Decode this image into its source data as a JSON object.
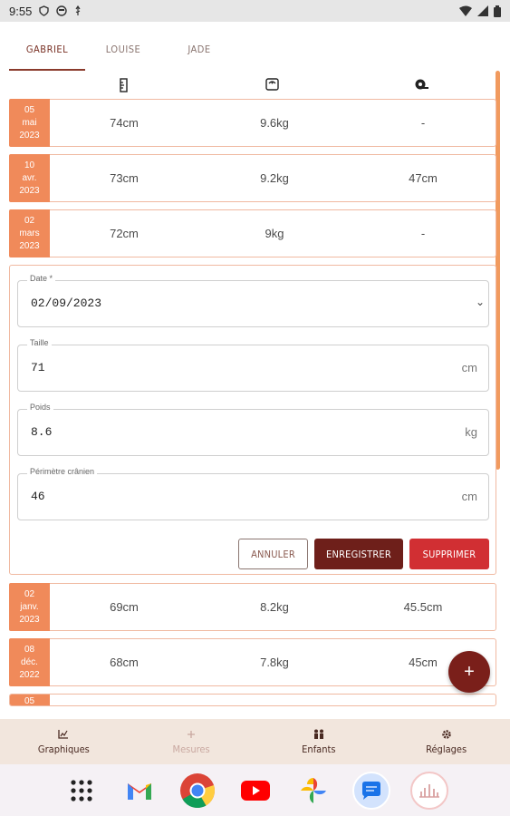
{
  "status_bar": {
    "time": "9:55"
  },
  "tabs": [
    {
      "label": "GABRIEL",
      "active": true
    },
    {
      "label": "LOUISE",
      "active": false
    },
    {
      "label": "JADE",
      "active": false
    }
  ],
  "columns": {
    "icons": [
      "ruler-icon",
      "scale-icon",
      "tape-measure-icon"
    ]
  },
  "rows_top": [
    {
      "day": "05",
      "month": "mai",
      "year": "2023",
      "taille": "74cm",
      "poids": "9.6kg",
      "perimetre": "-"
    },
    {
      "day": "10",
      "month": "avr.",
      "year": "2023",
      "taille": "73cm",
      "poids": "9.2kg",
      "perimetre": "47cm"
    },
    {
      "day": "02",
      "month": "mars",
      "year": "2023",
      "taille": "72cm",
      "poids": "9kg",
      "perimetre": "-"
    }
  ],
  "edit_form": {
    "date": {
      "label": "Date *",
      "value": "02/09/2023"
    },
    "taille": {
      "label": "Taille",
      "value": "71",
      "unit": "cm"
    },
    "poids": {
      "label": "Poids",
      "value": "8.6",
      "unit": "kg"
    },
    "perimetre": {
      "label": "Périmètre crânien",
      "value": "46",
      "unit": "cm"
    },
    "buttons": {
      "cancel": "ANNULER",
      "save": "ENREGISTRER",
      "delete": "SUPPRIMER"
    }
  },
  "rows_bottom": [
    {
      "day": "02",
      "month": "janv.",
      "year": "2023",
      "taille": "69cm",
      "poids": "8.2kg",
      "perimetre": "45.5cm"
    },
    {
      "day": "08",
      "month": "déc.",
      "year": "2022",
      "taille": "68cm",
      "poids": "7.8kg",
      "perimetre": "45cm"
    }
  ],
  "partial_row": {
    "day": "05"
  },
  "fab": {
    "label": "+"
  },
  "bottom_nav": [
    {
      "label": "Graphiques",
      "icon": "chart-icon"
    },
    {
      "label": "Mesures",
      "icon": "plus-icon"
    },
    {
      "label": "Enfants",
      "icon": "people-icon"
    },
    {
      "label": "Réglages",
      "icon": "gear-icon"
    }
  ],
  "dock": [
    "apps-grid-icon",
    "gmail-icon",
    "chrome-icon",
    "youtube-icon",
    "photos-icon",
    "messages-icon",
    "growth-app-icon"
  ],
  "colors": {
    "accent": "#f08a5a",
    "primary": "#6e1f1a",
    "danger": "#d12f33",
    "nav_bg": "#f2e6dd"
  }
}
